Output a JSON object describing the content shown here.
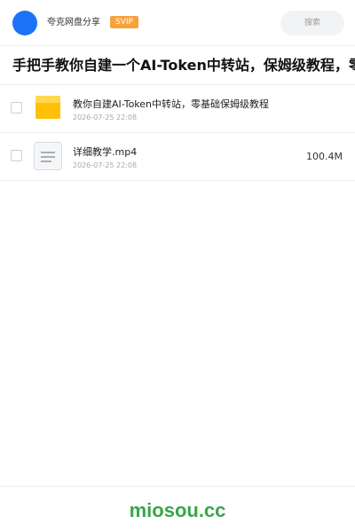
{
  "header": {
    "brand": "夸克网盘分享",
    "badge": "SVIP",
    "search_label": "搜索"
  },
  "share": {
    "title": "手把手教你自建一个AI-Token中转站，保姆级教程，零基础"
  },
  "files": [
    {
      "name": "教你自建AI-Token中转站，零基础保姆级教程",
      "date": "2026-07-25 22:08",
      "size": "",
      "icon": "folder-icon"
    },
    {
      "name": "详细教学.mp4",
      "date": "2026-07-25 22:08",
      "size": "100.4M",
      "icon": "file-icon"
    }
  ],
  "footer": {
    "brand": "miosou.cc"
  },
  "colors": {
    "accent": "#1a73f5",
    "badge": "#f7a23a",
    "folder": "#ffc107",
    "footer_brand": "#3aa54a"
  }
}
